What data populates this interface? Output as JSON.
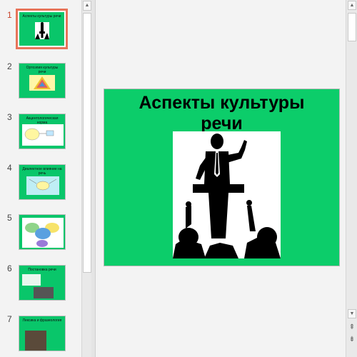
{
  "thumbnails": [
    {
      "number": "1",
      "title": "Аспекты культуры речи",
      "active": true
    },
    {
      "number": "2",
      "title": "Ортоэпия культуры речи",
      "active": false
    },
    {
      "number": "3",
      "title": "Акцентологическая норма",
      "active": false
    },
    {
      "number": "4",
      "title": "Диалектное влияние на речь",
      "active": false
    },
    {
      "number": "5",
      "title": "",
      "active": false
    },
    {
      "number": "6",
      "title": "Постановка речи",
      "active": false
    },
    {
      "number": "7",
      "title": "Лексика и фразеология",
      "active": false
    }
  ],
  "slide": {
    "title_line1": "Аспекты культуры",
    "title_line2": "речи",
    "background": "#0ccd6a"
  },
  "scroll_icons": {
    "up": "▲",
    "down": "▼",
    "prev_slide": "⇞",
    "next_slide": "⇟"
  }
}
